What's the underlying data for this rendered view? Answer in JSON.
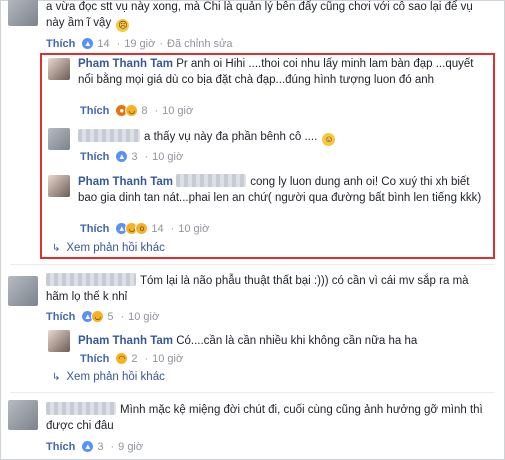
{
  "comments": [
    {
      "text": "a vừa đọc stt vụ này xong, mà Chi là quản lý bên đấy cũng chơi với cô sao lại để vụ này ầm ĩ vậy",
      "emoji": "☹",
      "meta": {
        "like": "Thích",
        "reactions": "14",
        "time": "19 giờ",
        "edited": "Đã chỉnh sửa"
      }
    },
    {
      "name": "Pham Thanh Tam",
      "text": "Pr anh oi Hihi ....thoi coi nhu lấy minh lam bàn đạp ...quyết nổi bằng mọi giá dù co bịa đặt chà đạp...đúng hình tượng luon đó anh",
      "meta": {
        "like": "Thích",
        "reactions": "8",
        "time": "10 giờ"
      }
    },
    {
      "text": "a thấy vụ này đa phần bênh cô ....",
      "emoji": "☺",
      "meta": {
        "like": "Thích",
        "reactions": "3",
        "time": "10 giờ"
      }
    },
    {
      "name": "Pham Thanh Tam",
      "text": "cong ly luon dung anh oi! Co xuý thi xh biết bao gia dinh tan nát...phai len an chứ( người qua đường bất bình len tiếng kkk)",
      "meta": {
        "like": "Thích",
        "reactions": "14",
        "time": "10 giờ"
      }
    },
    {
      "text": "Tóm lại là não phẫu thuật thất bại :))) có cần vì cái mv sắp ra mà hãm lọ thế k nhỉ",
      "meta": {
        "like": "Thích",
        "reactions": "5",
        "time": "10 giờ"
      }
    },
    {
      "name": "Pham Thanh Tam",
      "text": "Có....cần là cần nhiều khi không cần nữa ha ha",
      "meta": {
        "like": "Thích",
        "reactions": "2",
        "time": "10 giờ"
      }
    },
    {
      "text": "Mình mặc kệ miệng đời chút đi, cuối cùng cũng ảnh hưởng gỡ mình thì được chi đâu",
      "meta": {
        "like": "Thích",
        "reactions": "3",
        "time": "9 giờ"
      }
    }
  ],
  "more_replies": "Xem phản hồi khác",
  "reaction_icons": {
    "like": "👍",
    "haha": "😆",
    "wow": "😮",
    "sad": "😢",
    "angry": "😠"
  },
  "colors": {
    "link": "#365899",
    "highlight": "#e12e2e",
    "meta": "#90949c"
  }
}
